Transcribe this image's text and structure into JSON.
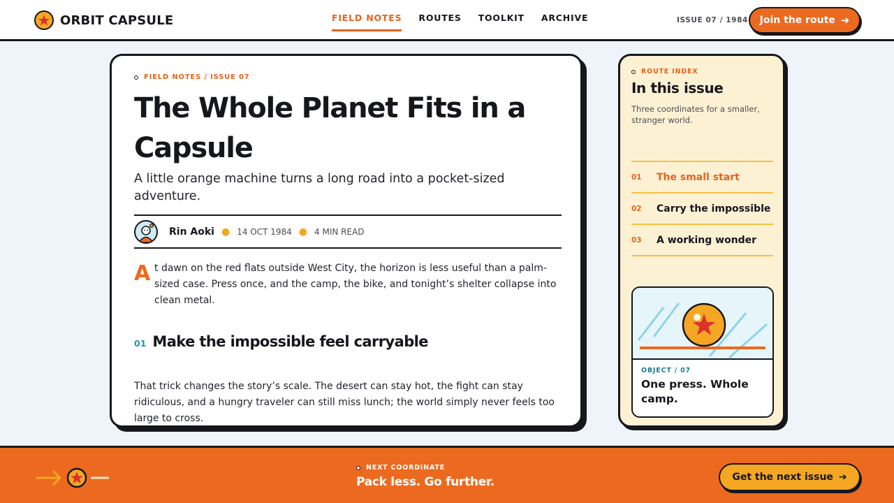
{
  "header": {
    "brand": "ORBIT CAPSULE",
    "nav": [
      "FIELD NOTES",
      "ROUTES",
      "TOOLKIT",
      "ARCHIVE"
    ],
    "active_nav": "FIELD NOTES",
    "issue": "ISSUE 07 / 1984",
    "cta_label": "Join the route"
  },
  "article": {
    "eyebrow": "FIELD NOTES / ISSUE 07",
    "title": "The Whole Planet Fits in a Capsule",
    "deck": "A little orange machine turns a long road into a pocket-sized adventure.",
    "author": "Rin Aoki",
    "date": "14 OCT 1984",
    "read_time": "4 MIN READ",
    "dropcap": "A",
    "lede": "t dawn on the red flats outside West City, the horizon is less useful than a palm-sized case. Press once, and the camp, the bike, and tonight’s shelter collapse into clean metal.",
    "section_number": "01",
    "section_title": "Make the impossible feel carryable",
    "paragraph": "That trick changes the story’s scale. The desert can stay hot, the fight can stay ridiculous, and a hungry traveler can still miss lunch; the world simply never feels too large to cross."
  },
  "sidebar": {
    "eyebrow": "ROUTE INDEX",
    "title": "In this issue",
    "subtitle": "Three coordinates for a smaller, stranger world.",
    "toc": [
      {
        "num": "01",
        "label": "The small start"
      },
      {
        "num": "02",
        "label": "Carry the impossible"
      },
      {
        "num": "03",
        "label": "A working wonder"
      }
    ],
    "object_tag": "OBJECT / 07",
    "object_title": "One press. Whole camp."
  },
  "footer": {
    "eyebrow": "NEXT COORDINATE",
    "title": "Pack less. Go further.",
    "cta_label": "Get the next issue"
  },
  "colors": {
    "accent": "#ec6a1f",
    "gold": "#f5a623",
    "ink": "#16171c",
    "teal": "#1c9ab3",
    "cream": "#fdf1d4"
  }
}
